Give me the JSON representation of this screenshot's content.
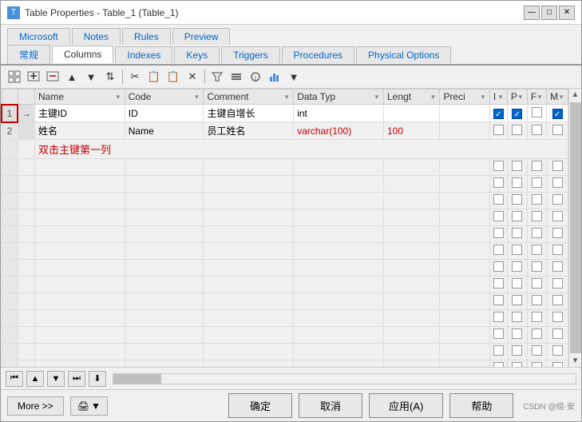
{
  "window": {
    "title": "Table Properties - Table_1 (Table_1)",
    "icon": "T"
  },
  "title_bar_controls": {
    "minimize": "—",
    "maximize": "□",
    "close": "✕"
  },
  "tabs_row1": {
    "items": [
      {
        "label": "Microsoft",
        "active": false
      },
      {
        "label": "Notes",
        "active": false
      },
      {
        "label": "Rules",
        "active": false
      },
      {
        "label": "Preview",
        "active": false
      }
    ]
  },
  "tabs_row2": {
    "items": [
      {
        "label": "常规",
        "active": false
      },
      {
        "label": "Columns",
        "active": true
      },
      {
        "label": "Indexes",
        "active": false
      },
      {
        "label": "Keys",
        "active": false
      },
      {
        "label": "Triggers",
        "active": false
      },
      {
        "label": "Procedures",
        "active": false
      },
      {
        "label": "Physical Options",
        "active": false
      }
    ]
  },
  "toolbar": {
    "buttons": [
      "📄",
      "📋",
      "🗑",
      "⬆",
      "⬇",
      "⬆⬇",
      "✂",
      "📋",
      "📋",
      "✕",
      "📌",
      "⚙",
      "🔧",
      "📊",
      "▼"
    ]
  },
  "table": {
    "columns": [
      {
        "label": "",
        "key": "rownum"
      },
      {
        "label": "Name",
        "key": "name"
      },
      {
        "label": "Code",
        "key": "code"
      },
      {
        "label": "Comment",
        "key": "comment"
      },
      {
        "label": "Data Typ",
        "key": "dtype"
      },
      {
        "label": "Lengt",
        "key": "length"
      },
      {
        "label": "Preci",
        "key": "prec"
      },
      {
        "label": "I",
        "key": "i"
      },
      {
        "label": "P",
        "key": "p"
      },
      {
        "label": "F",
        "key": "f"
      },
      {
        "label": "M",
        "key": "m"
      }
    ],
    "rows": [
      {
        "rownum": "1",
        "arrow": true,
        "name": "主键ID",
        "code": "ID",
        "comment": "主键自增长",
        "dtype": "int",
        "length": "",
        "prec": "",
        "i": true,
        "p": true,
        "f": false,
        "m": true
      },
      {
        "rownum": "2",
        "arrow": false,
        "name": "姓名",
        "code": "Name",
        "comment": "员工姓名",
        "dtype": "varchar(100)",
        "length": "100",
        "prec": "",
        "i": false,
        "p": false,
        "f": false,
        "m": false
      }
    ],
    "annotation": "双击主键第一列",
    "empty_rows": 18
  },
  "nav_buttons": [
    "⏮",
    "⬆",
    "⬇",
    "⏭",
    "⏬"
  ],
  "bottom": {
    "more_label": "More >>",
    "print_label": "🖨 ▼",
    "confirm_label": "确定",
    "cancel_label": "取消",
    "apply_label": "应用(A)",
    "help_label": "帮助"
  },
  "watermark": "CSDN @组·安"
}
